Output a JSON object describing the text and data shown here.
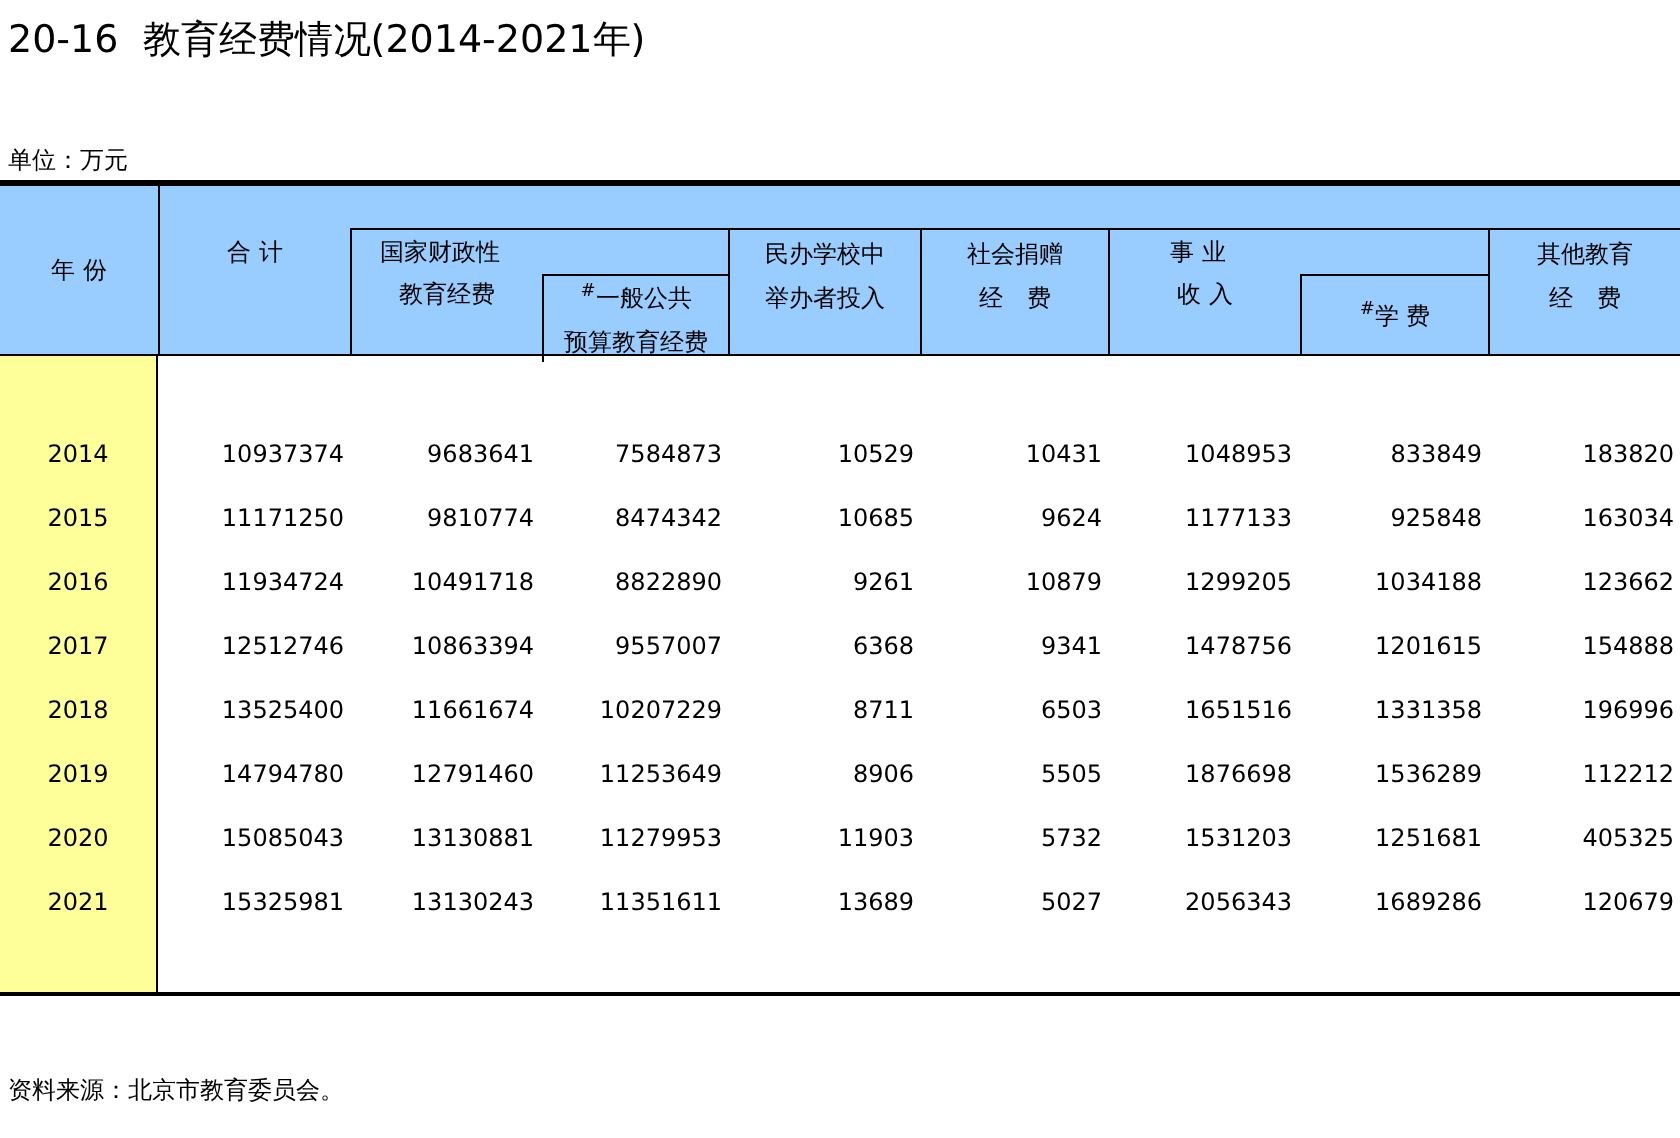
{
  "title": "20-16  教育经费情况(2014-2021年)",
  "unit": "单位：万元",
  "header": {
    "year": "年 份",
    "columns": [
      {
        "kind": "single",
        "lines": [
          "合 计"
        ]
      },
      {
        "kind": "group",
        "lines": [
          "国家财政性",
          "教育经费"
        ],
        "sub": [
          "$^{#}$一般公共",
          "预算教育经费"
        ]
      },
      {
        "kind": "single",
        "lines": [
          "民办学校中",
          "举办者投入"
        ]
      },
      {
        "kind": "single",
        "lines": [
          "社会捐赠",
          "经　费"
        ]
      },
      {
        "kind": "group",
        "lines": [
          "事 业",
          "收 入"
        ],
        "sub": [
          "$^{#}$学 费"
        ]
      },
      {
        "kind": "single",
        "lines": [
          "其他教育",
          "经　费"
        ]
      }
    ]
  },
  "rows": [
    {
      "year": "2014",
      "values": [
        "10937374",
        "9683641",
        "7584873",
        "10529",
        "10431",
        "1048953",
        "833849",
        "183820"
      ]
    },
    {
      "year": "2015",
      "values": [
        "11171250",
        "9810774",
        "8474342",
        "10685",
        "9624",
        "1177133",
        "925848",
        "163034"
      ]
    },
    {
      "year": "2016",
      "values": [
        "11934724",
        "10491718",
        "8822890",
        "9261",
        "10879",
        "1299205",
        "1034188",
        "123662"
      ]
    },
    {
      "year": "2017",
      "values": [
        "12512746",
        "10863394",
        "9557007",
        "6368",
        "9341",
        "1478756",
        "1201615",
        "154888"
      ]
    },
    {
      "year": "2018",
      "values": [
        "13525400",
        "11661674",
        "10207229",
        "8711",
        "6503",
        "1651516",
        "1331358",
        "196996"
      ]
    },
    {
      "year": "2019",
      "values": [
        "14794780",
        "12791460",
        "11253649",
        "8906",
        "5505",
        "1876698",
        "1536289",
        "112212"
      ]
    },
    {
      "year": "2020",
      "values": [
        "15085043",
        "13130881",
        "11279953",
        "11903",
        "5732",
        "1531203",
        "1251681",
        "405325"
      ]
    },
    {
      "year": "2021",
      "values": [
        "15325981",
        "13130243",
        "11351611",
        "13689",
        "5027",
        "2056343",
        "1689286",
        "120679"
      ]
    }
  ],
  "source": "资料来源：北京市教育委员会。"
}
